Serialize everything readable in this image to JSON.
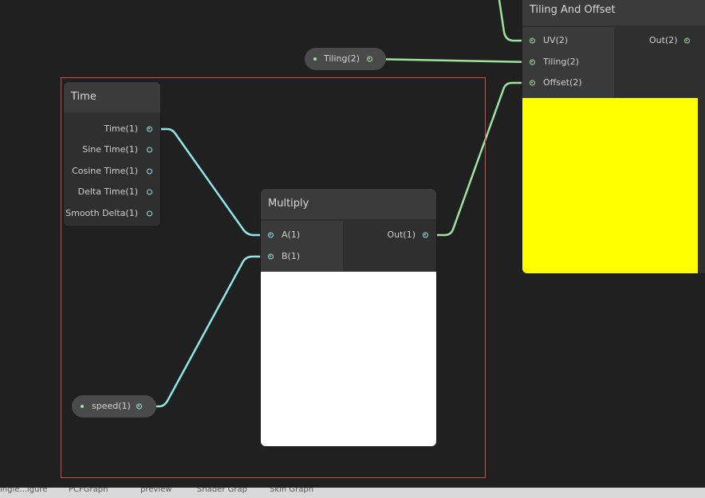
{
  "nodes": {
    "time": {
      "title": "Time",
      "outputs": [
        "Time(1)",
        "Sine Time(1)",
        "Cosine Time(1)",
        "Delta Time(1)",
        "Smooth Delta(1)"
      ]
    },
    "multiply": {
      "title": "Multiply",
      "inputs": [
        "A(1)",
        "B(1)"
      ],
      "output": "Out(1)",
      "preview_color": "#ffffff"
    },
    "tiling_offset": {
      "title": "Tiling And Offset",
      "inputs": [
        "UV(2)",
        "Tiling(2)",
        "Offset(2)"
      ],
      "output": "Out(2)",
      "preview_color": "#ffff00"
    }
  },
  "properties": {
    "tiling": "Tiling(2)",
    "speed": "speed(1)"
  },
  "colors": {
    "float_wire": "#8fe6e6",
    "vector2_wire": "#9ee39e",
    "group_border": "#d04a4a",
    "background": "#202020"
  },
  "taskbar_tabs": [
    "ingle...igure",
    "PCFGraph",
    "preview",
    "Shader Grap",
    "Skin Graph"
  ]
}
